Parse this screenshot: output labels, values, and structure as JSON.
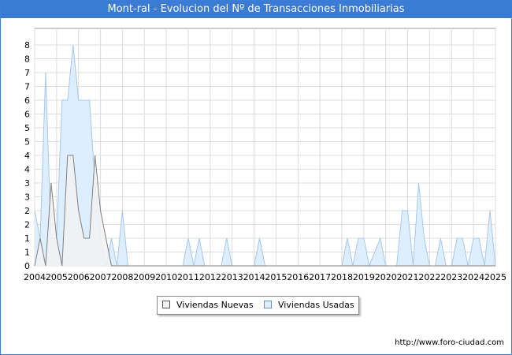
{
  "header": {
    "title": "Mont-ral - Evolucion del Nº de Transacciones Inmobiliarias"
  },
  "footer": {
    "url": "http://www.foro-ciudad.com"
  },
  "colors": {
    "title_bg": "#3a7bd5",
    "nuevas_fill": "#f2f2f2",
    "nuevas_line": "#808080",
    "usadas_fill": "#ddeeff",
    "usadas_line": "#a8c8e8",
    "grid": "#dddddd"
  },
  "chart_data": {
    "type": "area",
    "title": "Mont-ral - Evolucion del Nº de Transacciones Inmobiliarias",
    "xlabel": "",
    "ylabel": "",
    "x_ticks": [
      "2004",
      "2005",
      "2006",
      "2007",
      "2008",
      "2009",
      "2010",
      "2011",
      "2012",
      "2013",
      "2014",
      "2015",
      "2016",
      "2017",
      "2018",
      "2019",
      "2020",
      "2021",
      "2022",
      "2023",
      "2024",
      "2025"
    ],
    "y_ticks": [
      "0",
      "1",
      "1",
      "2",
      "2",
      "3",
      "3",
      "4",
      "4",
      "5",
      "5",
      "6",
      "6",
      "7",
      "7",
      "8",
      "8"
    ],
    "ylim": [
      0,
      8.6
    ],
    "xlim": [
      2004,
      2025
    ],
    "grid": true,
    "legend_position": "bottom-center",
    "series": [
      {
        "name": "Viviendas Nuevas",
        "points": [
          [
            2004,
            0
          ],
          [
            2004.25,
            1
          ],
          [
            2004.5,
            0
          ],
          [
            2004.75,
            3
          ],
          [
            2005,
            1
          ],
          [
            2005.25,
            0
          ],
          [
            2005.5,
            4
          ],
          [
            2005.75,
            4
          ],
          [
            2006,
            2
          ],
          [
            2006.25,
            1
          ],
          [
            2006.5,
            1
          ],
          [
            2006.75,
            4
          ],
          [
            2007,
            2
          ],
          [
            2007.25,
            1
          ],
          [
            2007.5,
            0
          ],
          [
            2025,
            0
          ]
        ]
      },
      {
        "name": "Viviendas Usadas",
        "points": [
          [
            2004,
            2
          ],
          [
            2004.25,
            1
          ],
          [
            2004.5,
            7
          ],
          [
            2004.75,
            1
          ],
          [
            2005,
            1
          ],
          [
            2005.25,
            6
          ],
          [
            2005.5,
            6
          ],
          [
            2005.75,
            8
          ],
          [
            2006,
            6
          ],
          [
            2006.25,
            6
          ],
          [
            2006.5,
            6
          ],
          [
            2006.75,
            3
          ],
          [
            2007,
            1
          ],
          [
            2007.25,
            0
          ],
          [
            2007.5,
            1
          ],
          [
            2007.75,
            0
          ],
          [
            2008,
            2
          ],
          [
            2008.25,
            0
          ],
          [
            2010.75,
            0
          ],
          [
            2011,
            1
          ],
          [
            2011.25,
            0
          ],
          [
            2011.5,
            1
          ],
          [
            2011.75,
            0
          ],
          [
            2012.5,
            0
          ],
          [
            2012.75,
            1
          ],
          [
            2013,
            0
          ],
          [
            2014,
            0
          ],
          [
            2014.25,
            1
          ],
          [
            2014.5,
            0
          ],
          [
            2018,
            0
          ],
          [
            2018.25,
            1
          ],
          [
            2018.5,
            0
          ],
          [
            2018.75,
            1
          ],
          [
            2019,
            1
          ],
          [
            2019.25,
            0
          ],
          [
            2019.75,
            1
          ],
          [
            2020,
            0
          ],
          [
            2020.5,
            0
          ],
          [
            2020.75,
            2
          ],
          [
            2021,
            2
          ],
          [
            2021.25,
            0
          ],
          [
            2021.5,
            3
          ],
          [
            2021.75,
            1
          ],
          [
            2022,
            0
          ],
          [
            2022.25,
            0
          ],
          [
            2022.5,
            1
          ],
          [
            2022.75,
            0
          ],
          [
            2023,
            0
          ],
          [
            2023.25,
            1
          ],
          [
            2023.5,
            1
          ],
          [
            2023.75,
            0
          ],
          [
            2024,
            1
          ],
          [
            2024.25,
            1
          ],
          [
            2024.5,
            0
          ],
          [
            2024.75,
            2
          ],
          [
            2025,
            0
          ]
        ]
      }
    ]
  }
}
